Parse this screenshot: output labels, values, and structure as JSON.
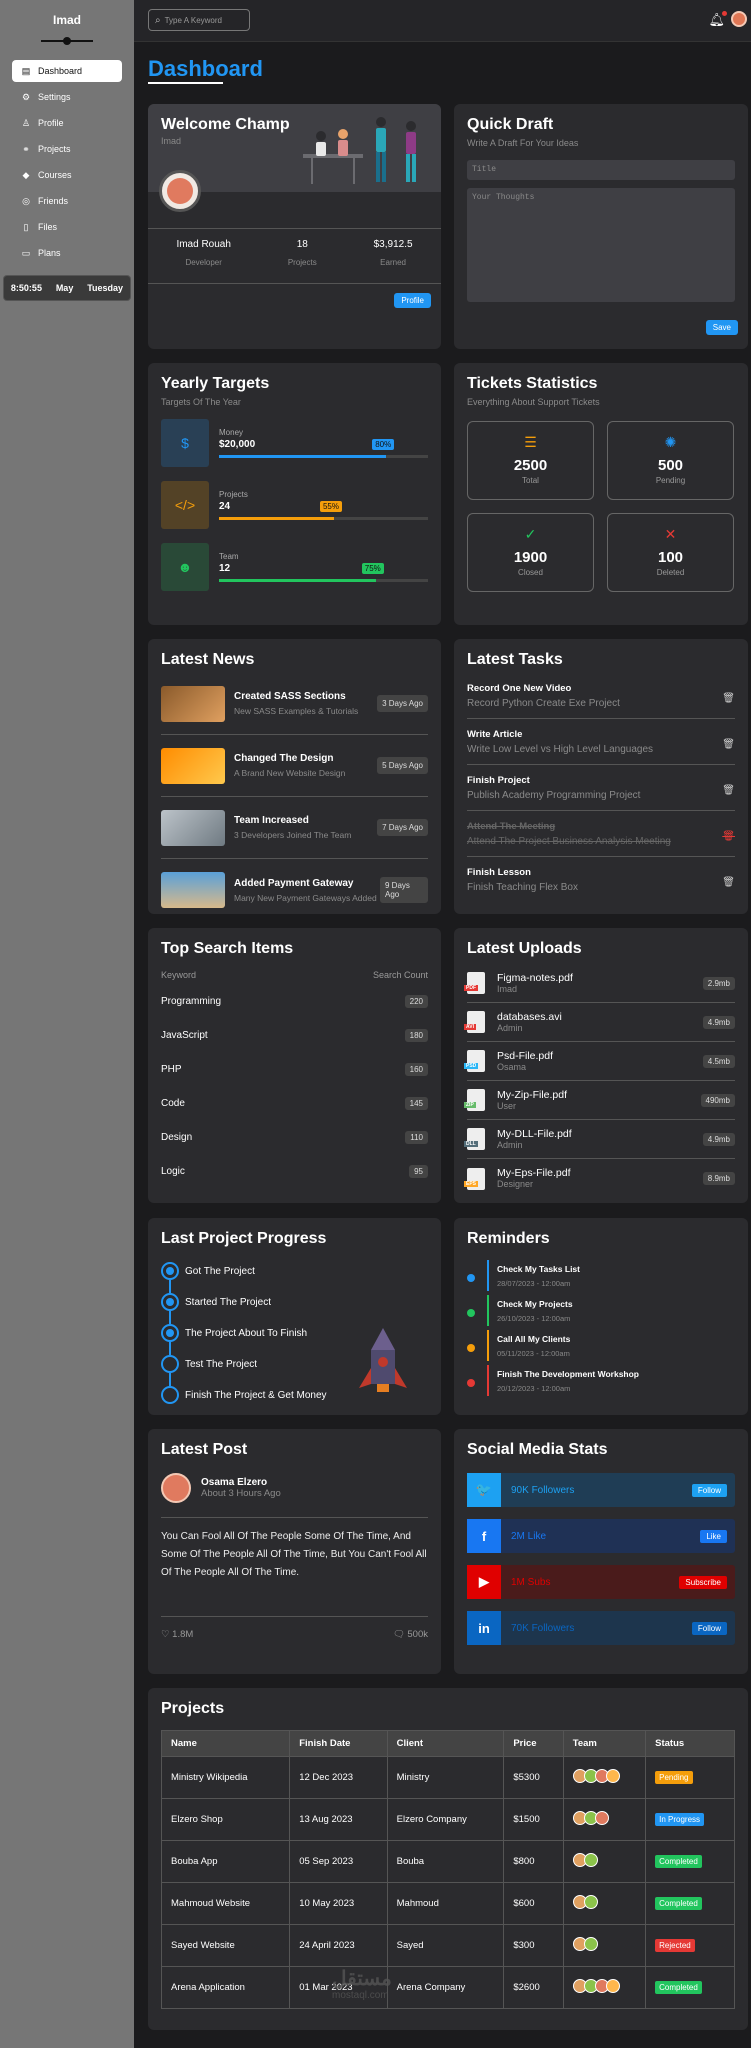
{
  "sidebar": {
    "brand": "Imad",
    "items": [
      {
        "label": "Dashboard",
        "icon": "chart-icon",
        "active": true
      },
      {
        "label": "Settings",
        "icon": "gear-icon",
        "active": false
      },
      {
        "label": "Profile",
        "icon": "user-icon",
        "active": false
      },
      {
        "label": "Projects",
        "icon": "diagram-icon",
        "active": false
      },
      {
        "label": "Courses",
        "icon": "graduation-cap-icon",
        "active": false
      },
      {
        "label": "Friends",
        "icon": "circle-user-icon",
        "active": false
      },
      {
        "label": "Files",
        "icon": "file-icon",
        "active": false
      },
      {
        "label": "Plans",
        "icon": "credit-card-icon",
        "active": false
      }
    ],
    "clock": {
      "time": "8:50:55",
      "month": "May",
      "day": "Tuesday"
    }
  },
  "topbar": {
    "search_placeholder": "Type A Keyword"
  },
  "page_title": "Dashboard",
  "welcome": {
    "title": "Welcome Champ",
    "name_sub": "Imad",
    "stats": [
      {
        "value": "Imad Rouah",
        "label": "Developer"
      },
      {
        "value": "18",
        "label": "Projects"
      },
      {
        "value": "$3,912.5",
        "label": "Earned"
      }
    ],
    "button": "Profile"
  },
  "draft": {
    "title": "Quick Draft",
    "sub": "Write A Draft For Your Ideas",
    "title_placeholder": "Title",
    "body_placeholder": "Your Thoughts",
    "button": "Save"
  },
  "targets": {
    "title": "Yearly Targets",
    "sub": "Targets Of The Year",
    "items": [
      {
        "label": "Money",
        "value": "$20,000",
        "percent": "80%",
        "fill": 0.8,
        "color": "#2196f3",
        "icon": "dollar-icon",
        "glyph": "$"
      },
      {
        "label": "Projects",
        "value": "24",
        "percent": "55%",
        "fill": 0.55,
        "color": "#f59e0b",
        "icon": "code-icon",
        "glyph": "</>"
      },
      {
        "label": "Team",
        "value": "12",
        "percent": "75%",
        "fill": 0.75,
        "color": "#22c55e",
        "icon": "user-icon",
        "glyph": "☻"
      }
    ]
  },
  "tickets": {
    "title": "Tickets Statistics",
    "sub": "Everything About Support Tickets",
    "items": [
      {
        "value": "2500",
        "label": "Total",
        "color": "#f59e0b",
        "icon": "list-icon",
        "glyph": "☰"
      },
      {
        "value": "500",
        "label": "Pending",
        "color": "#2196f3",
        "icon": "spinner-icon",
        "glyph": "✺"
      },
      {
        "value": "1900",
        "label": "Closed",
        "color": "#22c55e",
        "icon": "check-circle-icon",
        "glyph": "✓"
      },
      {
        "value": "100",
        "label": "Deleted",
        "color": "#e53935",
        "icon": "x-square-icon",
        "glyph": "✕"
      }
    ]
  },
  "news": {
    "title": "Latest News",
    "items": [
      {
        "title": "Created SASS Sections",
        "sub": "New SASS Examples & Tutorials",
        "ago": "3 Days Ago"
      },
      {
        "title": "Changed The Design",
        "sub": "A Brand New Website Design",
        "ago": "5 Days Ago"
      },
      {
        "title": "Team Increased",
        "sub": "3 Developers Joined The Team",
        "ago": "7 Days Ago"
      },
      {
        "title": "Added Payment Gateway",
        "sub": "Many New Payment Gateways Added",
        "ago": "9 Days Ago"
      }
    ]
  },
  "tasks": {
    "title": "Latest Tasks",
    "items": [
      {
        "title": "Record One New Video",
        "sub": "Record Python Create Exe Project"
      },
      {
        "title": "Write Article",
        "sub": "Write Low Level vs High Level Languages"
      },
      {
        "title": "Finish Project",
        "sub": "Publish Academy Programming Project"
      },
      {
        "title": "Attend The Meeting",
        "sub": "Attend The Project Business Analysis Meeting"
      },
      {
        "title": "Finish Lesson",
        "sub": "Finish Teaching Flex Box"
      }
    ]
  },
  "search_items": {
    "title": "Top Search Items",
    "col_keyword": "Keyword",
    "col_count": "Search Count",
    "rows": [
      {
        "k": "Programming",
        "c": "220"
      },
      {
        "k": "JavaScript",
        "c": "180"
      },
      {
        "k": "PHP",
        "c": "160"
      },
      {
        "k": "Code",
        "c": "145"
      },
      {
        "k": "Design",
        "c": "110"
      },
      {
        "k": "Logic",
        "c": "95"
      }
    ]
  },
  "uploads": {
    "title": "Latest Uploads",
    "items": [
      {
        "name": "Figma-notes.pdf",
        "by": "Imad",
        "size": "2.9mb",
        "tag": "PDF",
        "color": "#e53935"
      },
      {
        "name": "databases.avi",
        "by": "Admin",
        "size": "4.9mb",
        "tag": "AVI",
        "color": "#e53935"
      },
      {
        "name": "Psd-File.pdf",
        "by": "Osama",
        "size": "4.5mb",
        "tag": "PSD",
        "color": "#29b6f6"
      },
      {
        "name": "My-Zip-File.pdf",
        "by": "User",
        "size": "490mb",
        "tag": "ZIP",
        "color": "#66bb6a"
      },
      {
        "name": "My-DLL-File.pdf",
        "by": "Admin",
        "size": "4.9mb",
        "tag": "DLL",
        "color": "#546e7a"
      },
      {
        "name": "My-Eps-File.pdf",
        "by": "Designer",
        "size": "8.9mb",
        "tag": "EPS",
        "color": "#ffa726"
      }
    ]
  },
  "progress": {
    "title": "Last Project Progress",
    "items": [
      {
        "label": "Got The Project",
        "done": true
      },
      {
        "label": "Started The Project",
        "done": true
      },
      {
        "label": "The Project About To Finish",
        "done": true
      },
      {
        "label": "Test The Project",
        "done": false
      },
      {
        "label": "Finish The Project & Get Money",
        "done": false
      }
    ]
  },
  "reminders": {
    "title": "Reminders",
    "items": [
      {
        "title": "Check My Tasks List",
        "date": "28/07/2023 - 12:00am",
        "color": "#2196f3"
      },
      {
        "title": "Check My Projects",
        "date": "26/10/2023 - 12:00am",
        "color": "#22c55e"
      },
      {
        "title": "Call All My Clients",
        "date": "05/11/2023 - 12:00am",
        "color": "#f59e0b"
      },
      {
        "title": "Finish The Development Workshop",
        "date": "20/12/2023 - 12:00am",
        "color": "#e53935"
      }
    ]
  },
  "post": {
    "title": "Latest Post",
    "author": "Osama Elzero",
    "time": "About 3 Hours Ago",
    "body": "You Can Fool All Of The People Some Of The Time, And Some Of The People All Of The Time, But You Can't Fool All Of The People All Of The Time.",
    "likes": "1.8M",
    "comments": "500k"
  },
  "social": {
    "title": "Social Media Stats",
    "items": [
      {
        "text": "90K Followers",
        "button": "Follow",
        "color": "#1da1f2",
        "bg": "#1f3d55",
        "icon": "twitter-icon",
        "glyph": "🐦"
      },
      {
        "text": "2M Like",
        "button": "Like",
        "color": "#1877f2",
        "bg": "#1f3155",
        "icon": "facebook-icon",
        "glyph": "f"
      },
      {
        "text": "1M Subs",
        "button": "Subscribe",
        "color": "#e00000",
        "bg": "#4a1b1b",
        "icon": "youtube-icon",
        "glyph": "▶"
      },
      {
        "text": "70K Followers",
        "button": "Follow",
        "color": "#0a66c2",
        "bg": "#1d354d",
        "icon": "linkedin-icon",
        "glyph": "in"
      }
    ]
  },
  "projects": {
    "title": "Projects",
    "headers": [
      "Name",
      "Finish Date",
      "Client",
      "Price",
      "Team",
      "Status"
    ],
    "rows": [
      {
        "name": "Ministry Wikipedia",
        "date": "12 Dec 2023",
        "client": "Ministry",
        "price": "$5300",
        "team": 4,
        "status": "Pending",
        "scolor": "#f59e0b"
      },
      {
        "name": "Elzero Shop",
        "date": "13 Aug 2023",
        "client": "Elzero Company",
        "price": "$1500",
        "team": 3,
        "status": "In Progress",
        "scolor": "#2196f3"
      },
      {
        "name": "Bouba App",
        "date": "05 Sep 2023",
        "client": "Bouba",
        "price": "$800",
        "team": 2,
        "status": "Completed",
        "scolor": "#22c55e"
      },
      {
        "name": "Mahmoud Website",
        "date": "10 May 2023",
        "client": "Mahmoud",
        "price": "$600",
        "team": 2,
        "status": "Completed",
        "scolor": "#22c55e"
      },
      {
        "name": "Sayed Website",
        "date": "24 April 2023",
        "client": "Sayed",
        "price": "$300",
        "team": 2,
        "status": "Rejected",
        "scolor": "#e53935"
      },
      {
        "name": "Arena Application",
        "date": "01 Mar 2023",
        "client": "Arena Company",
        "price": "$2600",
        "team": 4,
        "status": "Completed",
        "scolor": "#22c55e"
      }
    ]
  },
  "watermark": {
    "text": "مستقل",
    "sub": "mostaql.com"
  }
}
